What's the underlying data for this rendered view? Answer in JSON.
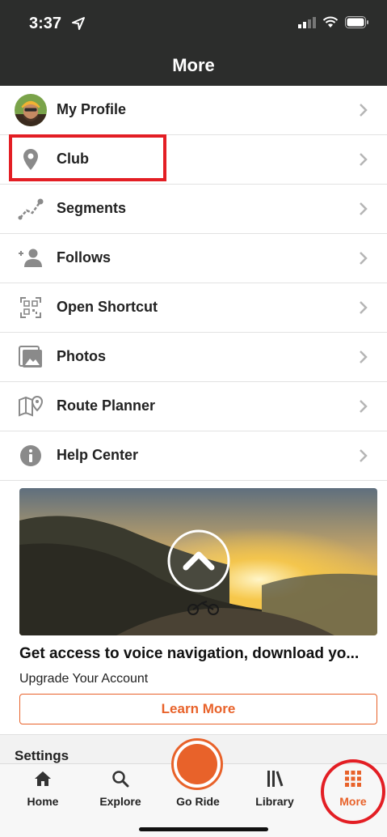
{
  "status_bar": {
    "time": "3:37"
  },
  "header": {
    "title": "More"
  },
  "menu": {
    "items": [
      {
        "label": "My Profile",
        "icon": "avatar"
      },
      {
        "label": "Club",
        "icon": "map-pin-icon"
      },
      {
        "label": "Segments",
        "icon": "segments-icon"
      },
      {
        "label": "Follows",
        "icon": "add-person-icon"
      },
      {
        "label": "Open Shortcut",
        "icon": "qr-code-icon"
      },
      {
        "label": "Photos",
        "icon": "photos-icon"
      },
      {
        "label": "Route Planner",
        "icon": "map-route-icon"
      },
      {
        "label": "Help Center",
        "icon": "info-icon"
      }
    ]
  },
  "promo": {
    "title": "Get access to voice navigation, download yo...",
    "subtitle": "Upgrade Your Account",
    "button_label": "Learn More"
  },
  "settings": {
    "label": "Settings"
  },
  "tab_bar": {
    "tabs": [
      {
        "label": "Home",
        "icon": "home-icon"
      },
      {
        "label": "Explore",
        "icon": "search-icon"
      },
      {
        "label": "Go Ride",
        "icon": "record-icon"
      },
      {
        "label": "Library",
        "icon": "library-icon"
      },
      {
        "label": "More",
        "icon": "grid-icon",
        "active": true
      }
    ]
  },
  "colors": {
    "accent": "#e8622a",
    "header_bg": "#2c2d2c",
    "annotation": "#e31e24",
    "icon_gray": "#8a8a8a"
  }
}
